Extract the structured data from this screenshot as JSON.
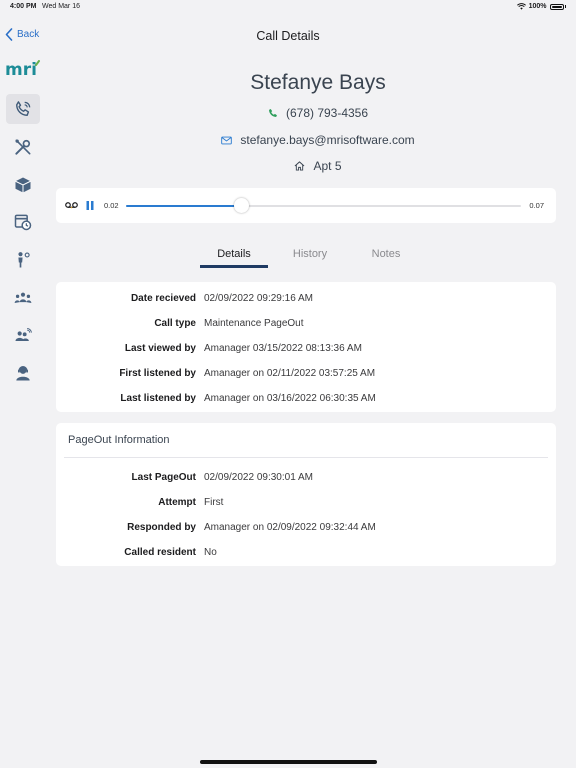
{
  "status_bar": {
    "time": "4:00 PM",
    "date": "Wed Mar 16",
    "battery": "100%"
  },
  "nav": {
    "back_label": "Back",
    "title": "Call Details"
  },
  "sidebar": {
    "logo_text": "mri",
    "items": [
      {
        "icon": "phone-call-icon",
        "active": true
      },
      {
        "icon": "tools-icon",
        "active": false
      },
      {
        "icon": "package-icon",
        "active": false
      },
      {
        "icon": "calendar-clock-icon",
        "active": false
      },
      {
        "icon": "person-pin-icon",
        "active": false
      },
      {
        "icon": "group-icon",
        "active": false
      },
      {
        "icon": "person-wifi-icon",
        "active": false
      },
      {
        "icon": "agent-icon",
        "active": false
      }
    ]
  },
  "contact": {
    "name": "Stefanye Bays",
    "phone": "(678) 793-4356",
    "email": "stefanye.bays@mrisoftware.com",
    "address": "Apt 5"
  },
  "player": {
    "current_time": "0.02",
    "total_time": "0.07",
    "progress": 0.29
  },
  "tabs": [
    {
      "label": "Details",
      "active": true
    },
    {
      "label": "History",
      "active": false
    },
    {
      "label": "Notes",
      "active": false
    }
  ],
  "details": [
    {
      "label": "Date recieved",
      "value": "02/09/2022 09:29:16 AM"
    },
    {
      "label": "Call type",
      "value": "Maintenance PageOut"
    },
    {
      "label": "Last viewed by",
      "value": "Amanager 03/15/2022 08:13:36 AM"
    },
    {
      "label": "First listened by",
      "value": "Amanager on 02/11/2022 03:57:25 AM"
    },
    {
      "label": "Last listened by",
      "value": "Amanager on 03/16/2022 06:30:35 AM"
    }
  ],
  "pageout": {
    "title": "PageOut Information",
    "rows": [
      {
        "label": "Last PageOut",
        "value": "02/09/2022 09:30:01 AM"
      },
      {
        "label": "Attempt",
        "value": "First"
      },
      {
        "label": "Responded by",
        "value": "Amanager on 02/09/2022 09:32:44 AM"
      },
      {
        "label": "Called resident",
        "value": "No"
      }
    ]
  },
  "colors": {
    "accent": "#2a7bd0",
    "tab_indicator": "#1f3b63",
    "phone_icon": "#2e9e5b",
    "logo_teal": "#1d8c97",
    "logo_green": "#6ab04c"
  }
}
